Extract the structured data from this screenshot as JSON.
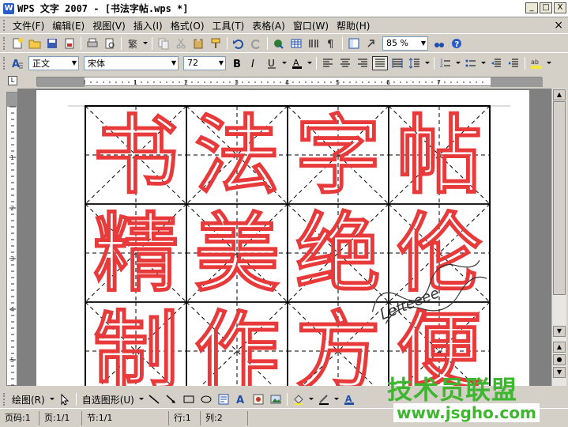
{
  "window": {
    "title": "WPS 文字 2007 - [书法字帖.wps *]",
    "controls": [
      "_",
      "□",
      "X"
    ]
  },
  "menubar": {
    "items": [
      "文件(F)",
      "编辑(E)",
      "视图(V)",
      "插入(I)",
      "格式(O)",
      "工具(T)",
      "表格(A)",
      "窗口(W)",
      "帮助(H)"
    ],
    "close": "×"
  },
  "toolbar": {
    "zoom": "85 %"
  },
  "format_bar": {
    "style": "正文",
    "font": "宋体",
    "size": "72"
  },
  "document": {
    "characters": [
      [
        "书",
        "法",
        "字",
        "帖"
      ],
      [
        "精",
        "美",
        "绝",
        "伦"
      ],
      [
        "制",
        "作",
        "方",
        "便"
      ]
    ],
    "text_color": "#e83a3a",
    "stamp_text": "Lefteeee"
  },
  "drawbar": {
    "draw_label": "绘图(R)",
    "autoshape_label": "自选图形(U)"
  },
  "status": {
    "page_code": "页码:1",
    "page": "页:1/1",
    "section": "节:1/1",
    "line": "行:1",
    "column": "列:2"
  },
  "watermark": {
    "title": "技术员联盟",
    "url": "www.jsgho.com",
    "color": "#3fb630"
  }
}
